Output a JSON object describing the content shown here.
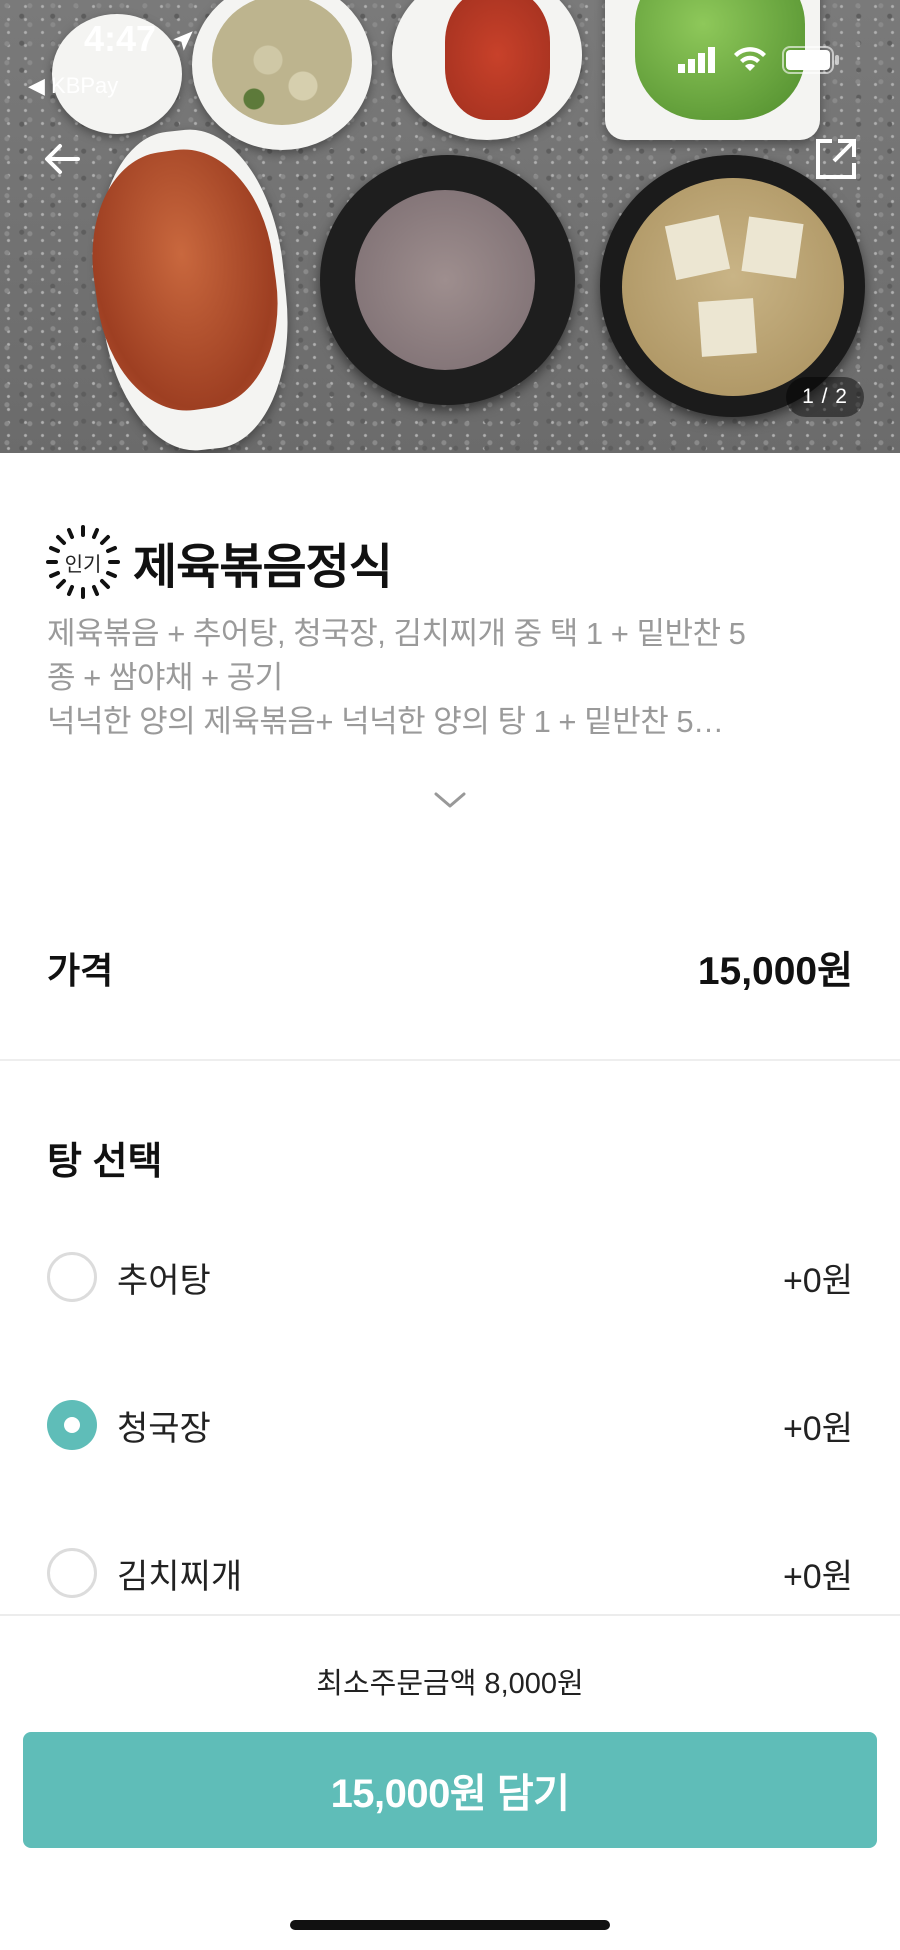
{
  "status_bar": {
    "time": "4:47",
    "back_app": "◀ KBPay"
  },
  "hero": {
    "image_counter": "1 / 2"
  },
  "product": {
    "badge": "인기",
    "name": "제육볶음정식",
    "description_lines": [
      "제육볶음 + 추어탕, 청국장, 김치찌개 중 택 1 + 밑반찬 5",
      "종 + 쌈야채 + 공기",
      "넉넉한 양의 제육볶음+ 넉넉한 양의 탕 1  + 밑반찬 5…"
    ]
  },
  "price": {
    "label": "가격",
    "value": "15,000원"
  },
  "soup_section": {
    "title": "탕 선택",
    "options": [
      {
        "label": "추어탕",
        "price": "+0원",
        "selected": false
      },
      {
        "label": "청국장",
        "price": "+0원",
        "selected": true
      },
      {
        "label": "김치찌개",
        "price": "+0원",
        "selected": false
      }
    ]
  },
  "footer": {
    "min_order": "최소주문금액 8,000원",
    "add_button": "15,000원 담기"
  },
  "colors": {
    "accent": "#5fbdb8"
  },
  "icons": [
    "back-arrow-icon",
    "share-icon",
    "signal-icon",
    "wifi-icon",
    "battery-icon",
    "location-arrow-icon",
    "chevron-down-icon",
    "popular-badge-icon"
  ]
}
